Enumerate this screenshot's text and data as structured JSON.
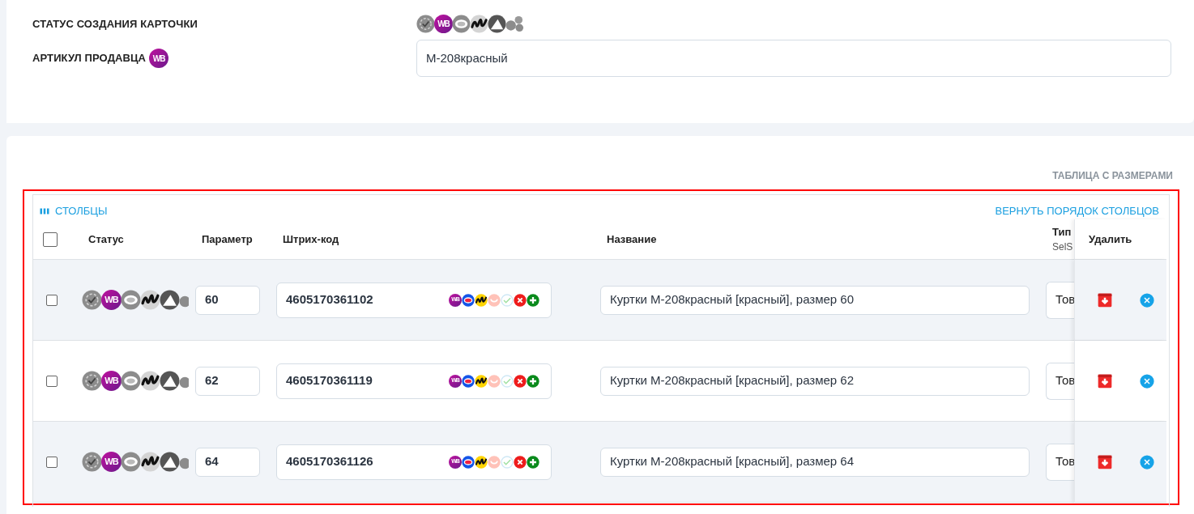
{
  "card_status": {
    "label": "СТАТУС СОЗДАНИЯ КАРТОЧКИ",
    "marketplaces": [
      {
        "kind": "check",
        "active": false
      },
      {
        "kind": "wb",
        "active": true,
        "label": "WB"
      },
      {
        "kind": "ring",
        "active": false
      },
      {
        "kind": "m",
        "active": false
      },
      {
        "kind": "peak",
        "active": false
      },
      {
        "kind": "dots",
        "active": false
      }
    ]
  },
  "seller_sku": {
    "label": "АРТИКУЛ ПРОДАВЦА",
    "badge": "WB",
    "value": "М-208красный"
  },
  "sizes_table": {
    "title": "ТАБЛИЦА С РАЗМЕРАМИ",
    "columns_button": "СТОЛБЦЫ",
    "reset_order_link": "ВЕРНУТЬ ПОРЯДОК СТОЛБЦОВ",
    "select_all_checked": false,
    "columns": [
      {
        "label": "Статус"
      },
      {
        "label": "Параметр"
      },
      {
        "label": "Штрих-код"
      },
      {
        "label": "Название"
      },
      {
        "label": "Тип",
        "sublabel": "SelS"
      },
      {
        "label": "Удалить"
      }
    ],
    "rows": [
      {
        "checked": false,
        "statuses": [
          {
            "kind": "check",
            "active": false
          },
          {
            "kind": "wb",
            "active": true,
            "label": "WB"
          },
          {
            "kind": "ring",
            "active": false
          },
          {
            "kind": "m",
            "active": false
          },
          {
            "kind": "peak",
            "active": false
          },
          {
            "kind": "dots",
            "active": false
          }
        ],
        "size": "60",
        "barcode": "4605170361102",
        "barcode_badges": [
          {
            "kind": "wb",
            "label": "WB"
          },
          {
            "kind": "ozon"
          },
          {
            "kind": "yandex"
          },
          {
            "kind": "smile"
          },
          {
            "kind": "tick"
          },
          {
            "kind": "remove"
          },
          {
            "kind": "add"
          }
        ],
        "name": "Куртки М-208красный [красный], размер 60",
        "type": "Тов"
      },
      {
        "checked": false,
        "statuses": [
          {
            "kind": "check",
            "active": false
          },
          {
            "kind": "wb",
            "active": true,
            "label": "WB"
          },
          {
            "kind": "ring",
            "active": false
          },
          {
            "kind": "m",
            "active": false
          },
          {
            "kind": "peak",
            "active": false
          },
          {
            "kind": "dots",
            "active": false
          }
        ],
        "size": "62",
        "barcode": "4605170361119",
        "barcode_badges": [
          {
            "kind": "wb",
            "label": "WB"
          },
          {
            "kind": "ozon"
          },
          {
            "kind": "yandex"
          },
          {
            "kind": "smile"
          },
          {
            "kind": "tick"
          },
          {
            "kind": "remove"
          },
          {
            "kind": "add"
          }
        ],
        "name": "Куртки М-208красный [красный], размер 62",
        "type": "Тов"
      },
      {
        "checked": false,
        "statuses": [
          {
            "kind": "check",
            "active": false
          },
          {
            "kind": "wb",
            "active": true,
            "label": "WB"
          },
          {
            "kind": "ring",
            "active": false
          },
          {
            "kind": "m",
            "active": false
          },
          {
            "kind": "peak",
            "active": false
          },
          {
            "kind": "dots",
            "active": false
          }
        ],
        "size": "64",
        "barcode": "4605170361126",
        "barcode_badges": [
          {
            "kind": "wb",
            "label": "WB"
          },
          {
            "kind": "ozon"
          },
          {
            "kind": "yandex"
          },
          {
            "kind": "smile"
          },
          {
            "kind": "tick"
          },
          {
            "kind": "remove"
          },
          {
            "kind": "add"
          }
        ],
        "name": "Куртки М-208красный [красный], размер 64",
        "type": "Тов"
      }
    ]
  }
}
